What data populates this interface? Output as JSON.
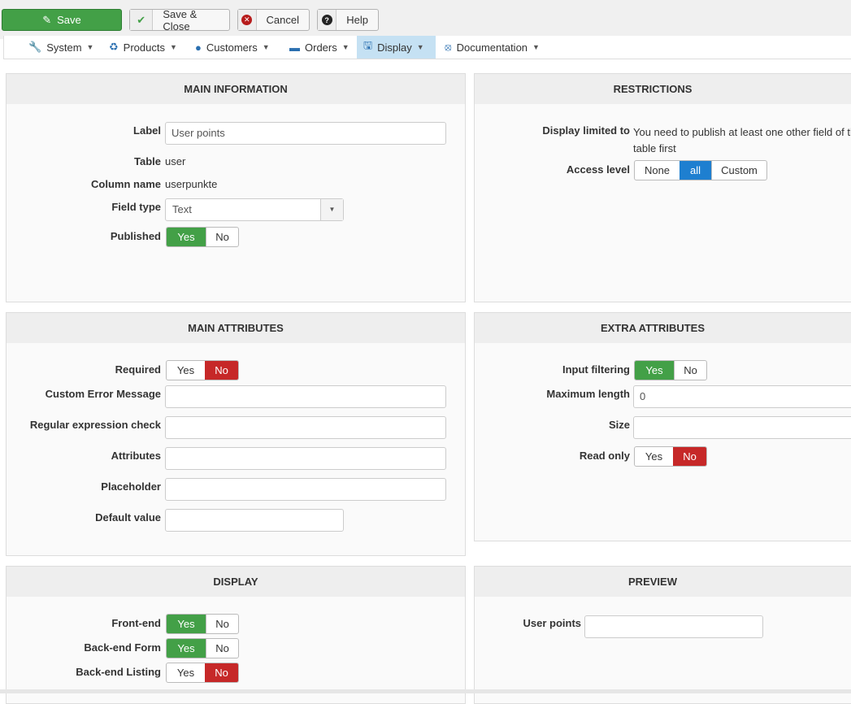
{
  "toolbar": {
    "save": "Save",
    "save_close": "Save & Close",
    "cancel": "Cancel",
    "help": "Help"
  },
  "nav": [
    {
      "label": "System",
      "icon": "wrench-icon"
    },
    {
      "label": "Products",
      "icon": "cubes-icon"
    },
    {
      "label": "Customers",
      "icon": "user-icon"
    },
    {
      "label": "Orders",
      "icon": "credit-card-icon"
    },
    {
      "label": "Display",
      "icon": "monitor-icon",
      "active": true
    },
    {
      "label": "Documentation",
      "icon": "lifebuoy-icon"
    }
  ],
  "main_info": {
    "title": "MAIN INFORMATION",
    "label_label": "Label",
    "label_value": "User points",
    "table_label": "Table",
    "table_value": "user",
    "column_label": "Column name",
    "column_value": "userpunkte",
    "field_type_label": "Field type",
    "field_type_value": "Text",
    "published_label": "Published",
    "published": "Yes",
    "yes": "Yes",
    "no": "No"
  },
  "restrictions": {
    "title": "RESTRICTIONS",
    "display_limited_label": "Display limited to",
    "display_limited_text": "You need to publish at least one other field of this table first",
    "access_label": "Access level",
    "access_options": [
      "None",
      "all",
      "Custom"
    ],
    "access_selected": "all"
  },
  "main_attributes": {
    "title": "MAIN ATTRIBUTES",
    "required_label": "Required",
    "required": "No",
    "custom_error_label": "Custom Error Message",
    "custom_error_value": "",
    "regex_label": "Regular expression check",
    "regex_value": "",
    "attributes_label": "Attributes",
    "attributes_value": "",
    "placeholder_label": "Placeholder",
    "placeholder_value": "",
    "default_label": "Default value",
    "default_value": "",
    "yes": "Yes",
    "no": "No"
  },
  "extra_attributes": {
    "title": "EXTRA ATTRIBUTES",
    "input_filtering_label": "Input filtering",
    "input_filtering": "Yes",
    "max_length_label": "Maximum length",
    "max_length_value": "0",
    "size_label": "Size",
    "size_value": "",
    "read_only_label": "Read only",
    "read_only": "No",
    "yes": "Yes",
    "no": "No"
  },
  "display": {
    "title": "DISPLAY",
    "frontend_label": "Front-end",
    "frontend": "Yes",
    "backend_form_label": "Back-end Form",
    "backend_form": "Yes",
    "backend_listing_label": "Back-end Listing",
    "backend_listing": "No",
    "yes": "Yes",
    "no": "No"
  },
  "preview": {
    "title": "PREVIEW",
    "user_points_label": "User points",
    "user_points_value": ""
  },
  "colors": {
    "success": "#43a047",
    "danger": "#c62828",
    "primary": "#1e7fd0",
    "nav_active": "#c5e1f3"
  }
}
